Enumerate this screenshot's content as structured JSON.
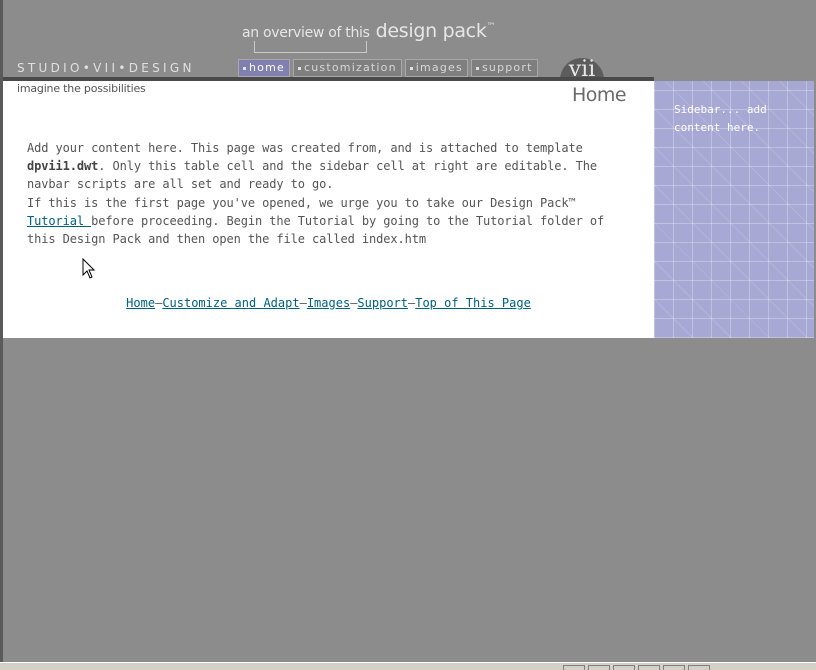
{
  "header": {
    "tagline_small": "an overview of this",
    "tagline_big": "design pack",
    "tagline_tm": "™",
    "brand": "STUDIO•VII•DESIGN",
    "logo": "vii",
    "subtag": "imagine the possibilities",
    "page_title": "Home"
  },
  "navbar": [
    {
      "label": "home",
      "active": true
    },
    {
      "label": "customization",
      "active": false
    },
    {
      "label": "images",
      "active": false
    },
    {
      "label": "support",
      "active": false
    }
  ],
  "content": {
    "p1_a": "Add your content here. This page was created from, and is attached to template ",
    "p1_b": "dpvii1.dwt",
    "p1_c": ". Only this table cell and the sidebar cell at right are editable. The navbar scripts are all set and ready to go.",
    "p2_a": "If this is the first page you've opened, we urge you to take our Design Pack™ ",
    "p2_link": "Tutorial ",
    "p2_b": "before proceeding. Begin the Tutorial by going to the Tutorial folder of this Design Pack and then open the file called index.htm"
  },
  "footer": {
    "links": [
      "Home",
      "Customize and Adapt",
      "Images",
      "Support",
      "Top of This Page"
    ],
    "separator": "—"
  },
  "sidebar": {
    "text": "Sidebar... add content here."
  },
  "colors": {
    "page_bg": "#8c8c8c",
    "sidebar_bg": "#a8a8d4",
    "link": "#00607f",
    "active_nav": "#7f7fb0"
  }
}
